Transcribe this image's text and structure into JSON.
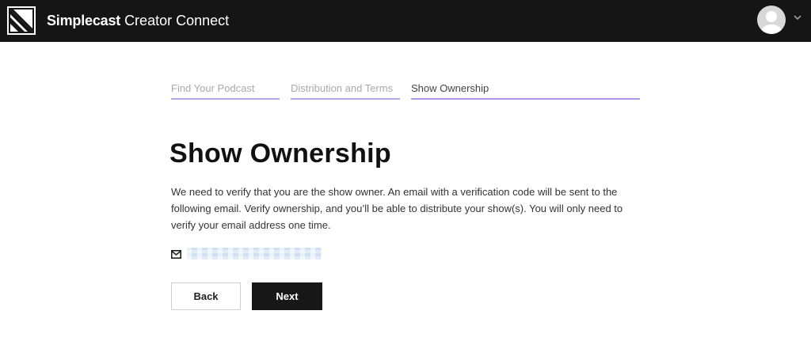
{
  "header": {
    "brand_strong": "Simplecast",
    "brand_light": "Creator Connect",
    "logo_icon": "simplecast-logo-icon",
    "user_avatar_icon": "user-avatar-icon",
    "menu_icon": "chevron-down-icon"
  },
  "steps": [
    {
      "label": "Find Your Podcast",
      "state": "completed"
    },
    {
      "label": "Distribution and Terms",
      "state": "completed"
    },
    {
      "label": "Show Ownership",
      "state": "current"
    }
  ],
  "main": {
    "title": "Show Ownership",
    "description": "We need to verify that you are the show owner. An email with a verification code will be sent to the following email. Verify ownership, and you’ll be able to distribute your show(s). You will only need to verify your email address one time.",
    "email": {
      "icon": "mail-icon",
      "value": "",
      "redacted": true
    }
  },
  "actions": {
    "back_label": "Back",
    "next_label": "Next"
  },
  "colors": {
    "header_bg": "#151515",
    "step_underline": "#b8a4e8",
    "primary_button": "#171717"
  }
}
